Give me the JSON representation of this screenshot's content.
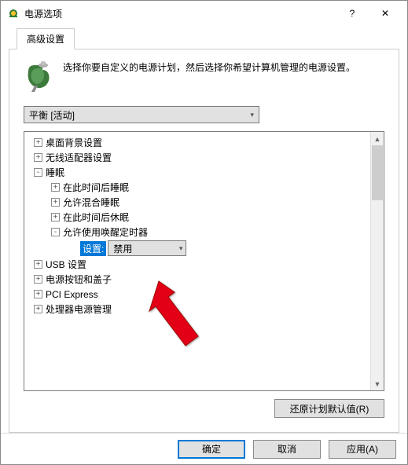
{
  "window": {
    "title": "电源选项"
  },
  "tab": {
    "label": "高级设置"
  },
  "description": "选择你要自定义的电源计划，然后选择你希望计算机管理的电源设置。",
  "plan": {
    "selected": "平衡 [活动]"
  },
  "tree": {
    "items": [
      {
        "exp": "+",
        "indent": 0,
        "label": "桌面背景设置"
      },
      {
        "exp": "+",
        "indent": 0,
        "label": "无线适配器设置"
      },
      {
        "exp": "-",
        "indent": 0,
        "label": "睡眠"
      },
      {
        "exp": "+",
        "indent": 1,
        "label": "在此时间后睡眠"
      },
      {
        "exp": "+",
        "indent": 1,
        "label": "允许混合睡眠"
      },
      {
        "exp": "+",
        "indent": 1,
        "label": "在此时间后休眠"
      },
      {
        "exp": "-",
        "indent": 1,
        "label": "允许使用唤醒定时器"
      },
      {
        "exp": "+",
        "indent": 0,
        "label": "USB 设置"
      },
      {
        "exp": "+",
        "indent": 0,
        "label": "电源按钮和盖子"
      },
      {
        "exp": "+",
        "indent": 0,
        "label": "PCI Express"
      },
      {
        "exp": "+",
        "indent": 0,
        "label": "处理器电源管理"
      }
    ],
    "setting": {
      "label": "设置:",
      "value": "禁用",
      "indent": 2
    }
  },
  "buttons": {
    "restore": "还原计划默认值(R)",
    "ok": "确定",
    "cancel": "取消",
    "apply": "应用(A)"
  }
}
